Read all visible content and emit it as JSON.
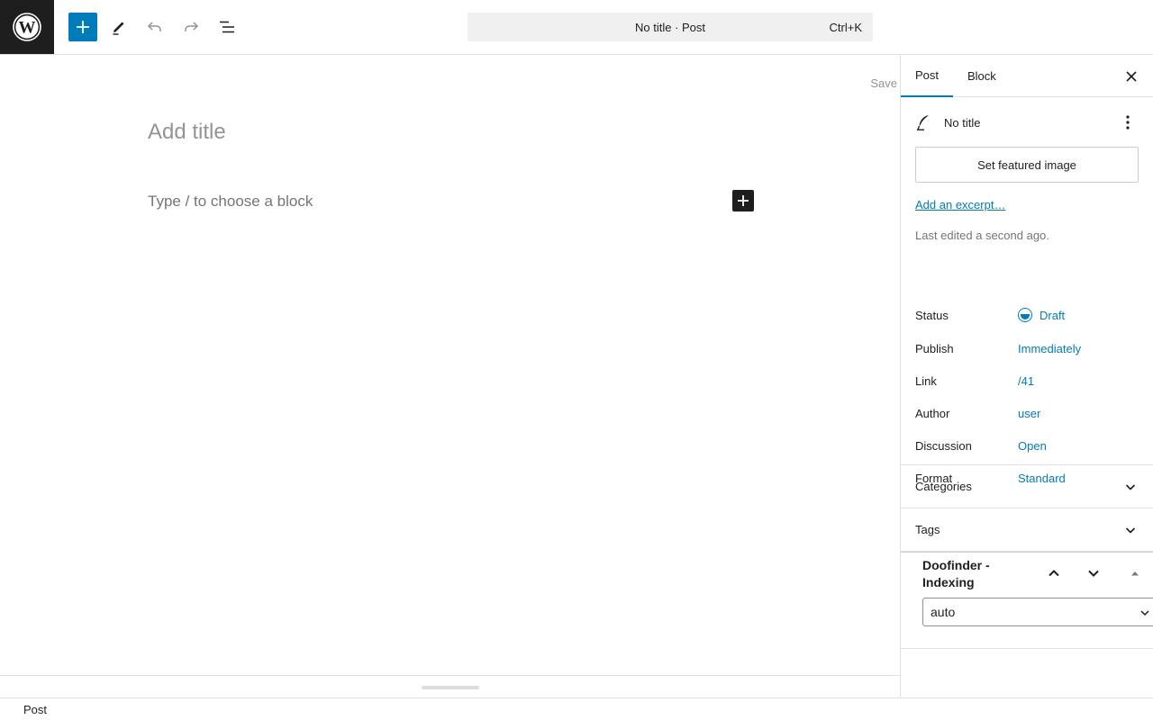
{
  "toolbar": {
    "logo_icon": "wordpress-logo-icon",
    "add_icon": "plus-icon",
    "tools_icon": "pencil-icon",
    "undo_icon": "undo-icon",
    "redo_icon": "redo-icon",
    "list_view_icon": "list-view-icon",
    "command_bar_title": "No title · Post",
    "command_bar_shortcut": "Ctrl+K",
    "accent_color": "#007cba"
  },
  "canvas": {
    "save_label": "Save",
    "title_placeholder": "Add title",
    "block_placeholder": "Type / to choose a block"
  },
  "sidebar": {
    "tabs": [
      {
        "label": "Post",
        "active": true
      },
      {
        "label": "Block",
        "active": false
      }
    ],
    "post_title": "No title",
    "featured_image_label": "Set featured image",
    "excerpt_link": "Add an excerpt…",
    "last_edited": "Last edited a second ago.",
    "properties": [
      {
        "label": "Status",
        "value": "Draft"
      },
      {
        "label": "Publish",
        "value": "Immediately"
      },
      {
        "label": "Link",
        "value": "/41"
      },
      {
        "label": "Author",
        "value": "user"
      },
      {
        "label": "Discussion",
        "value": "Open"
      },
      {
        "label": "Format",
        "value": "Standard"
      }
    ],
    "panels": [
      {
        "label": "Categories"
      },
      {
        "label": "Tags"
      }
    ],
    "metabox": {
      "title": "Doofinder - Indexing",
      "select_value": "auto"
    }
  },
  "footer": {
    "breadcrumb": "Post"
  }
}
